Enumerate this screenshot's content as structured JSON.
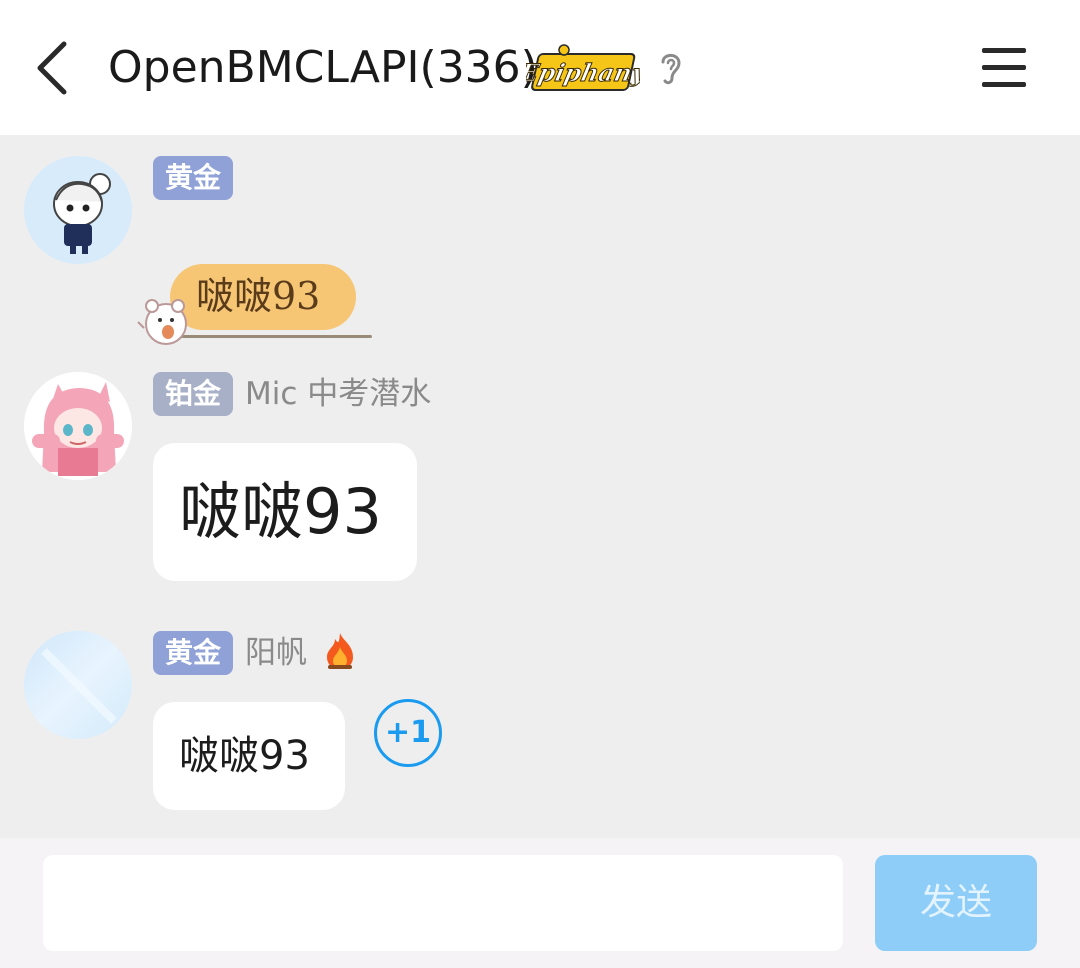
{
  "header": {
    "title": "OpenBMCLAPI(336)",
    "group_badge_text": "Epiphany"
  },
  "messages": [
    {
      "rank": "黄金",
      "nickname": "",
      "text": "啵啵93",
      "style": "fancy-bubble"
    },
    {
      "rank": "铂金",
      "nickname": "Mic 中考潜水",
      "text": "啵啵93",
      "style": "large-text"
    },
    {
      "rank": "黄金",
      "nickname": "阳帆",
      "nickname_icon": "fire-icon",
      "text": "啵啵93",
      "plus_one": "+1"
    }
  ],
  "input": {
    "value": "",
    "send_label": "发送"
  },
  "colors": {
    "rank_gold": "#8fa1d6",
    "rank_platinum": "#a8b0c8",
    "accent": "#1a9bf0",
    "send_button": "#8ecdf8",
    "fancy_bubble": "#f6c675"
  }
}
